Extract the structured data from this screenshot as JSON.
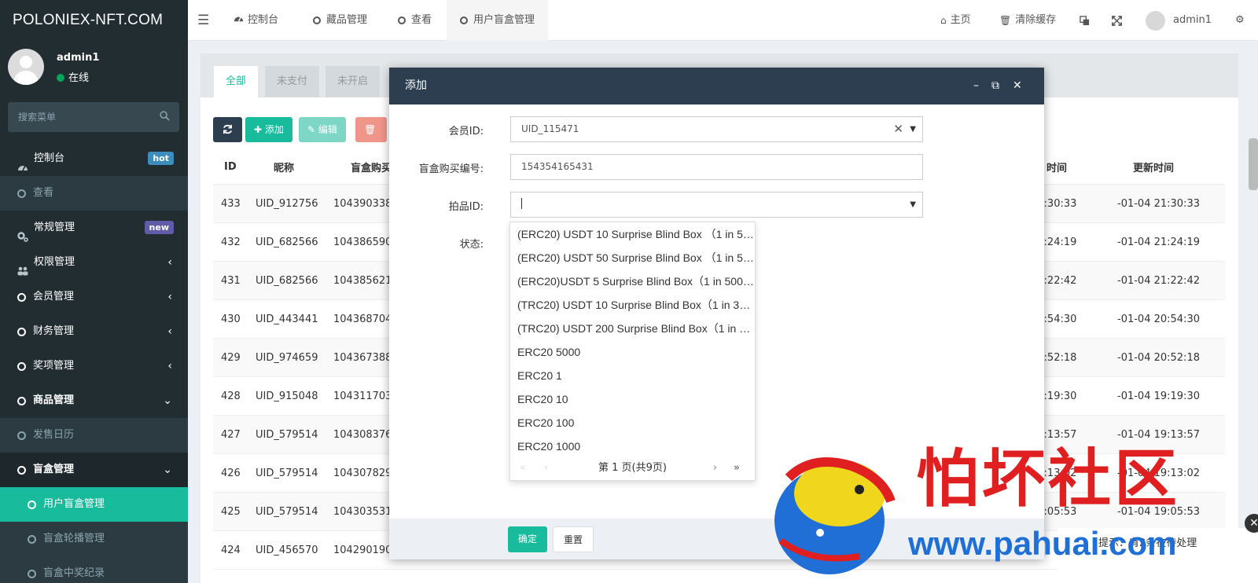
{
  "app": {
    "logo": "POLONIEX-NFT.COM"
  },
  "user": {
    "name": "admin1",
    "status": "在线"
  },
  "sidebar": {
    "search_placeholder": "搜索菜单",
    "items": [
      {
        "label": "控制台",
        "badge": "hot",
        "icon": "dashboard-icon"
      },
      {
        "label": "查看",
        "icon": "circle-icon"
      },
      {
        "label": "常规管理",
        "badge": "new",
        "icon": "cogs-icon"
      },
      {
        "label": "权限管理",
        "icon": "group-icon",
        "arrow": "‹"
      },
      {
        "label": "会员管理",
        "icon": "circle-icon",
        "arrow": "‹"
      },
      {
        "label": "财务管理",
        "icon": "circle-icon",
        "arrow": "‹"
      },
      {
        "label": "奖项管理",
        "icon": "circle-icon",
        "arrow": "‹"
      },
      {
        "label": "商品管理",
        "icon": "circle-icon",
        "arrow": "⌄"
      },
      {
        "label": "发售日历",
        "icon": "circle-icon"
      },
      {
        "label": "盲盒管理",
        "icon": "circle-icon",
        "arrow": "⌄"
      },
      {
        "label": "用户盲盒管理",
        "icon": "circle-icon"
      },
      {
        "label": "盲盒轮播管理",
        "icon": "circle-icon"
      },
      {
        "label": "盲盒中奖纪录",
        "icon": "circle-icon"
      }
    ]
  },
  "header": {
    "menu_icon": "☰",
    "tabs": [
      {
        "label": "控制台",
        "icon": "dashboard-icon"
      },
      {
        "label": "藏品管理",
        "icon": "circle-icon"
      },
      {
        "label": "查看",
        "icon": "circle-icon"
      },
      {
        "label": "用户盲盒管理",
        "icon": "circle-icon"
      }
    ],
    "home": "主页",
    "clear_cache": "清除缓存",
    "admin": "admin1"
  },
  "content": {
    "tabs": [
      "全部",
      "未支付",
      "未开启"
    ],
    "toolbar": {
      "add": "添加",
      "edit": "编辑",
      "delete": "删除"
    },
    "table": {
      "headers": [
        "ID",
        "昵称",
        "盲盒购买",
        "时间",
        "更新时间"
      ],
      "rows": [
        {
          "id": "433",
          "nick": "UID_912756",
          "order": "104390338",
          "created": "21:30:33",
          "updated": "-01-04 21:30:33"
        },
        {
          "id": "432",
          "nick": "UID_682566",
          "order": "104386590",
          "created": "21:24:19",
          "updated": "-01-04 21:24:19"
        },
        {
          "id": "431",
          "nick": "UID_682566",
          "order": "104385621",
          "created": "21:22:42",
          "updated": "-01-04 21:22:42"
        },
        {
          "id": "430",
          "nick": "UID_443441",
          "order": "104368704",
          "created": "20:54:30",
          "updated": "-01-04 20:54:30"
        },
        {
          "id": "429",
          "nick": "UID_974659",
          "order": "104367388",
          "created": "20:52:18",
          "updated": "-01-04 20:52:18"
        },
        {
          "id": "428",
          "nick": "UID_915048",
          "order": "104311703",
          "created": "19:19:30",
          "updated": "-01-04 19:19:30"
        },
        {
          "id": "427",
          "nick": "UID_579514",
          "order": "104308376",
          "created": "19:13:57",
          "updated": "-01-04 19:13:57"
        },
        {
          "id": "426",
          "nick": "UID_579514",
          "order": "104307829",
          "created": "19:13:02",
          "updated": "-01-04 19:13:02"
        },
        {
          "id": "425",
          "nick": "UID_579514",
          "order": "104303531",
          "created": "19:05:53",
          "updated": "-01-04 19:05:53"
        },
        {
          "id": "424",
          "nick": "UID_456570",
          "order": "104290190",
          "created": "",
          "updated": ""
        }
      ]
    }
  },
  "modal": {
    "title": "添加",
    "fields": {
      "member_label": "会员ID:",
      "member_value": "UID_115471",
      "order_label": "盲盒购买编号:",
      "order_value": "154354165431",
      "item_label": "拍品ID:",
      "item_value": "",
      "status_label": "状态:"
    },
    "confirm": "确定",
    "reset": "重置"
  },
  "dropdown": {
    "options": [
      "(ERC20) USDT 10 Surprise Blind Box （1 in 5…",
      "(ERC20) USDT 50 Surprise Blind Box （1 in 5…",
      "(ERC20)USDT 5 Surprise Blind Box（1 in 500 …",
      "(TRC20) USDT 10 Surprise Blind Box（1 in 30…",
      "(TRC20) USDT 200 Surprise Blind Box（1 in 2…",
      "ERC20 5000",
      "ERC20 1",
      "ERC20 10",
      "ERC20 100",
      "ERC20 1000"
    ],
    "pager": "第 1 页(共9页)"
  },
  "watermark": {
    "brand": "怕坏社区",
    "url": "www.pahuai.com"
  },
  "notice": {
    "text": "提示：有2条在待处理"
  },
  "colors": {
    "sidebar": "#222d32",
    "accent": "#18bc9c",
    "modal_header": "#2c3e50",
    "watermark_red": "#e02020",
    "watermark_blue": "#1f6fd6"
  }
}
